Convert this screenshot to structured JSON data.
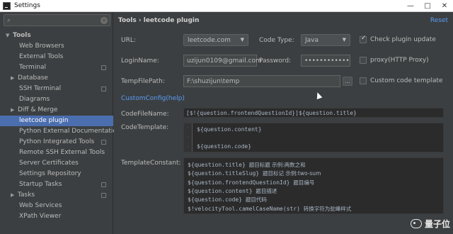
{
  "window": {
    "title": "Settings",
    "controls": [
      "—",
      "□",
      "✕"
    ]
  },
  "search": {
    "value": ""
  },
  "sidebar": {
    "section": "Tools",
    "items": [
      {
        "label": "Web Browsers",
        "arrow": false,
        "proj": false
      },
      {
        "label": "External Tools",
        "arrow": false,
        "proj": false
      },
      {
        "label": "Terminal",
        "arrow": false,
        "proj": true
      },
      {
        "label": "Database",
        "arrow": true,
        "proj": false
      },
      {
        "label": "SSH Terminal",
        "arrow": false,
        "proj": true
      },
      {
        "label": "Diagrams",
        "arrow": false,
        "proj": false
      },
      {
        "label": "Diff & Merge",
        "arrow": true,
        "proj": false
      },
      {
        "label": "leetcode plugin",
        "arrow": false,
        "proj": false,
        "selected": true
      },
      {
        "label": "Python External Documentation",
        "arrow": false,
        "proj": false
      },
      {
        "label": "Python Integrated Tools",
        "arrow": false,
        "proj": true
      },
      {
        "label": "Remote SSH External Tools",
        "arrow": false,
        "proj": false
      },
      {
        "label": "Server Certificates",
        "arrow": false,
        "proj": false
      },
      {
        "label": "Settings Repository",
        "arrow": false,
        "proj": false
      },
      {
        "label": "Startup Tasks",
        "arrow": false,
        "proj": true
      },
      {
        "label": "Tasks",
        "arrow": true,
        "proj": true
      },
      {
        "label": "Web Services",
        "arrow": false,
        "proj": false
      },
      {
        "label": "XPath Viewer",
        "arrow": false,
        "proj": false
      }
    ]
  },
  "main": {
    "breadcrumb": "Tools › leetcode plugin",
    "reset": "Reset",
    "url_label": "URL:",
    "url_value": "leetcode.com",
    "code_type_label": "Code Type:",
    "code_type_value": "Java",
    "check_update_label": "Check plugin update",
    "login_label": "LoginName:",
    "login_value": "uzijun0109@gmail.com",
    "password_label": "Password:",
    "password_value": "••••••••••••",
    "proxy_label": "proxy(HTTP Proxy)",
    "temp_label": "TempFilePath:",
    "temp_value": "F:\\shuzijun\\temp",
    "browse": "...",
    "custom_template_label": "Custom code template",
    "custom_config_link": "CustomConfig(help)",
    "codefilename_label": "CodeFileName:",
    "codefilename_value": "[$!{question.frontendQuestionId}]${question.title}",
    "codetemplate_label": "CodeTemplate:",
    "codetemplate_lines": [
      "${question.content}",
      "",
      "${question.code}"
    ],
    "templateconstant_label": "TemplateConstant:",
    "constants": [
      {
        "code": "${question.title}",
        "desc": "题目标题 示例:两数之和"
      },
      {
        "code": "${question.titleSlug}",
        "desc": "题目标记 示例:two-sum"
      },
      {
        "code": "${question.frontendQuestionId}",
        "desc": "题目编号"
      },
      {
        "code": "${question.content}",
        "desc": "题目描述"
      },
      {
        "code": "${question.code}",
        "desc": "题目代码"
      },
      {
        "code": "$!velocityTool.camelCaseName(str)",
        "desc": "转换字符为驼峰样式"
      }
    ]
  },
  "watermark": "量子位"
}
